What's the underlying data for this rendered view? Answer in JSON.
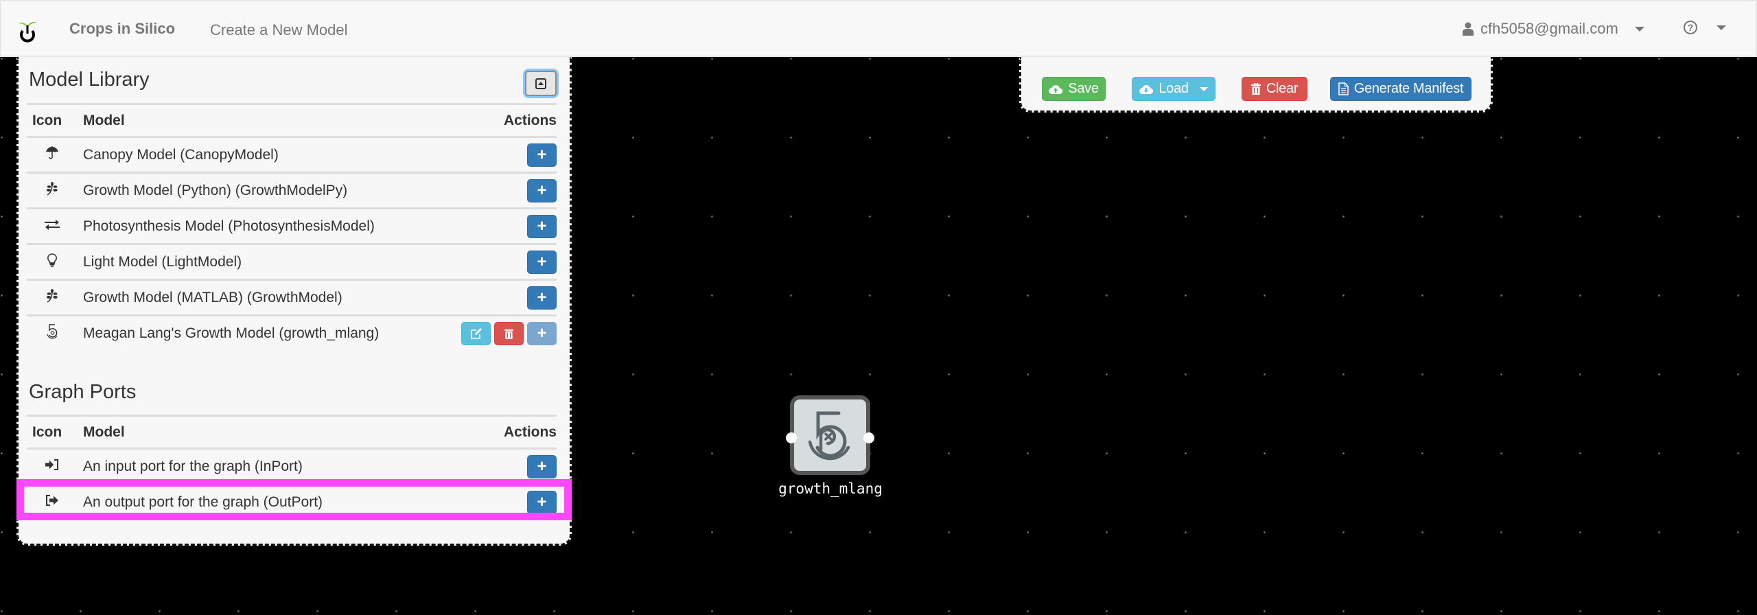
{
  "navbar": {
    "brand": "Crops in Silico",
    "nav_link": "Create a New Model",
    "user_email": "cfh5058@gmail.com",
    "help_icon": "question-circle-icon"
  },
  "toolbar": {
    "save_label": "Save",
    "load_label": "Load",
    "clear_label": "Clear",
    "manifest_label": "Generate Manifest"
  },
  "library": {
    "title": "Model Library",
    "columns": [
      "Icon",
      "Model",
      "Actions"
    ],
    "rows": [
      {
        "icon": "umbrella-icon",
        "glyph": "☂",
        "label": "Canopy Model (CanopyModel)",
        "actions": [
          "add"
        ]
      },
      {
        "icon": "leaf-icon",
        "glyph": "❦",
        "label": "Growth Model (Python) (GrowthModelPy)",
        "actions": [
          "add"
        ]
      },
      {
        "icon": "exchange-icon",
        "glyph": "⇄",
        "label": "Photosynthesis Model (PhotosynthesisModel)",
        "actions": [
          "add"
        ]
      },
      {
        "icon": "lightbulb-icon",
        "glyph": "💡",
        "label": "Light Model (LightModel)",
        "actions": [
          "add"
        ]
      },
      {
        "icon": "leaf-icon",
        "glyph": "❦",
        "label": "Growth Model (MATLAB) (GrowthModel)",
        "actions": [
          "add"
        ]
      },
      {
        "icon": "fivehundredpx-icon",
        "glyph": "5",
        "label": "Meagan Lang's Growth Model (growth_mlang)",
        "actions": [
          "edit",
          "delete",
          "add-disabled"
        ]
      }
    ]
  },
  "ports": {
    "title": "Graph Ports",
    "columns": [
      "Icon",
      "Model",
      "Actions"
    ],
    "rows": [
      {
        "icon": "sign-in-icon",
        "glyph": "⇥",
        "label": "An input port for the graph (InPort)",
        "actions": [
          "add"
        ]
      },
      {
        "icon": "sign-out-icon",
        "glyph": "⇥",
        "label": "An output port for the graph (OutPort)",
        "actions": [
          "add"
        ],
        "highlighted": true
      }
    ]
  },
  "graph": {
    "nodes": [
      {
        "label": "growth_mlang",
        "icon": "fivehundredpx-icon"
      }
    ]
  },
  "colors": {
    "highlight": "#ff47ff",
    "primary": "#337ab7",
    "success": "#5cb85c",
    "info": "#5bc0de",
    "danger": "#d9534f",
    "canvas": "#000000"
  }
}
